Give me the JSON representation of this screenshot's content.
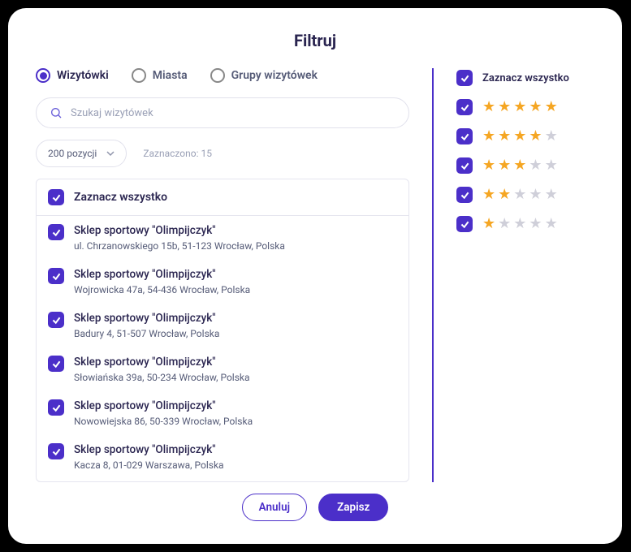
{
  "title": "Filtruj",
  "radios": {
    "wizytowki": "Wizytówki",
    "miasta": "Miasta",
    "grupy": "Grupy wizytówek"
  },
  "search": {
    "placeholder": "Szukaj wizytówek"
  },
  "pageSize": {
    "label": "200 pozycji"
  },
  "selectedInfo": "Zaznaczono: 15",
  "selectAll": "Zaznacz wszystko",
  "items": [
    {
      "name": "Sklep sportowy \"Olimpijczyk\"",
      "addr": "ul. Chrzanowskiego 15b, 51-123 Wrocław, Polska"
    },
    {
      "name": "Sklep sportowy \"Olimpijczyk\"",
      "addr": "Wojrowicka 47a, 54-436 Wrocław, Polska"
    },
    {
      "name": "Sklep sportowy \"Olimpijczyk\"",
      "addr": "Badury 4, 51-507 Wrocław, Polska"
    },
    {
      "name": "Sklep sportowy \"Olimpijczyk\"",
      "addr": "Słowiańska 39a, 50-234 Wrocław, Polska"
    },
    {
      "name": "Sklep sportowy \"Olimpijczyk\"",
      "addr": "Nowowiejska 86, 50-339 Wrocław, Polska"
    },
    {
      "name": "Sklep sportowy \"Olimpijczyk\"",
      "addr": "Kacza 8, 01-029 Warszawa, Polska"
    }
  ],
  "right": {
    "selectAll": "Zaznacz wszystko",
    "ratings": [
      5,
      4,
      3,
      2,
      1
    ]
  },
  "buttons": {
    "cancel": "Anuluj",
    "save": "Zapisz"
  }
}
